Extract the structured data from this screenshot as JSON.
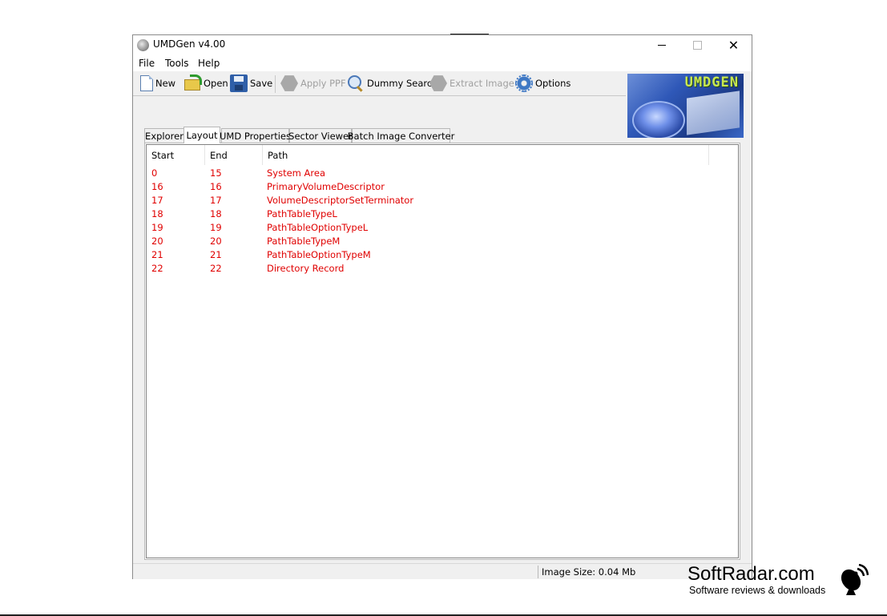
{
  "window": {
    "title": "UMDGen v4.00",
    "controls": {
      "minimize": "",
      "maximize": "",
      "close": "✕"
    }
  },
  "menu": [
    "File",
    "Tools",
    "Help"
  ],
  "toolbar": {
    "new": "New",
    "open": "Open",
    "save": "Save",
    "apply_ppf": "Apply PPF",
    "dummy_search": "Dummy Search",
    "extract_image": "Extract Image",
    "options": "Options"
  },
  "logo": {
    "text": "UMDGEN"
  },
  "tabs": [
    {
      "label": "Explorer",
      "active": false
    },
    {
      "label": "Layout",
      "active": true
    },
    {
      "label": "UMD Properties",
      "active": false
    },
    {
      "label": "Sector Viewer",
      "active": false
    },
    {
      "label": "Batch Image Converter",
      "active": false
    }
  ],
  "layout_table": {
    "columns": [
      "Start",
      "End",
      "Path"
    ],
    "row_color": "#e00000",
    "rows": [
      {
        "start": "0",
        "end": "15",
        "path": "System Area"
      },
      {
        "start": "16",
        "end": "16",
        "path": "PrimaryVolumeDescriptor"
      },
      {
        "start": "17",
        "end": "17",
        "path": "VolumeDescriptorSetTerminator"
      },
      {
        "start": "18",
        "end": "18",
        "path": "PathTableTypeL"
      },
      {
        "start": "19",
        "end": "19",
        "path": "PathTableOptionTypeL"
      },
      {
        "start": "20",
        "end": "20",
        "path": "PathTableTypeM"
      },
      {
        "start": "21",
        "end": "21",
        "path": "PathTableOptionTypeM"
      },
      {
        "start": "22",
        "end": "22",
        "path": "Directory Record"
      }
    ]
  },
  "status": {
    "image_size": "Image Size: 0.04 Mb"
  },
  "watermark": {
    "title": "SoftRadar.com",
    "subtitle": "Software reviews & downloads"
  }
}
